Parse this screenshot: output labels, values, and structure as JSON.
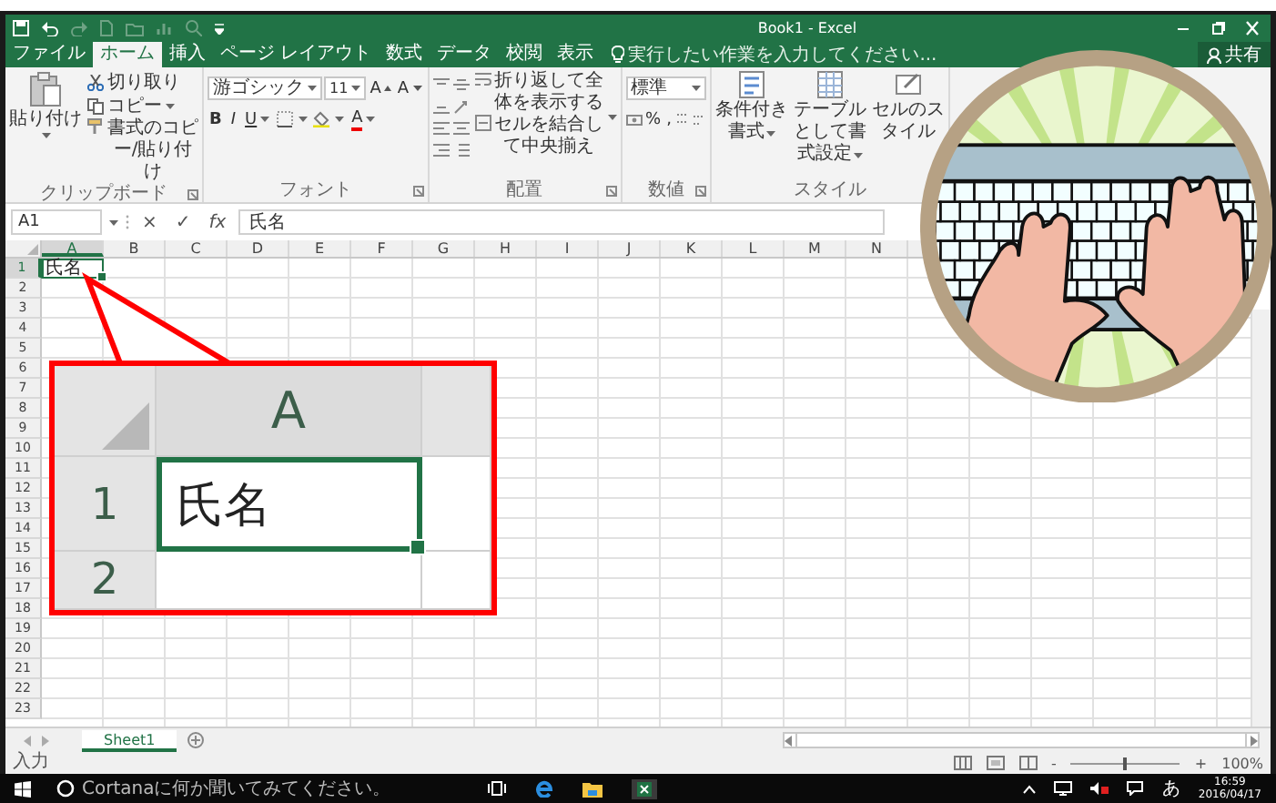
{
  "window": {
    "title": "Book1 - Excel"
  },
  "ribbon_tabs": [
    {
      "label": "ファイル",
      "selected": false
    },
    {
      "label": "ホーム",
      "selected": true
    },
    {
      "label": "挿入",
      "selected": false
    },
    {
      "label": "ページ レイアウト",
      "selected": false
    },
    {
      "label": "数式",
      "selected": false
    },
    {
      "label": "データ",
      "selected": false
    },
    {
      "label": "校閲",
      "selected": false
    },
    {
      "label": "表示",
      "selected": false
    }
  ],
  "tell_me": {
    "placeholder": "実行したい作業を入力してください..."
  },
  "share_button": "共有",
  "clipboard": {
    "paste": "貼り付け",
    "cut": "切り取り",
    "copy": "コピー",
    "format_painter": "書式のコピー/貼り付け",
    "label": "クリップボード"
  },
  "font": {
    "font_name": "游ゴシック",
    "font_size": "11",
    "grow": "A",
    "shrink": "A",
    "bold": "B",
    "italic": "I",
    "underline": "U",
    "font_color": "A",
    "label": "フォント"
  },
  "alignment": {
    "wrap_text": "折り返して全体を表示する",
    "merge_center": "セルを結合して中央揃え",
    "label": "配置"
  },
  "number": {
    "format": "標準",
    "percent": "%",
    "comma": ",",
    "label": "数値"
  },
  "styles": {
    "buttons": [
      "条件付き書式",
      "テーブルとして書式設定",
      "セルのスタイル"
    ],
    "label": "スタイル"
  },
  "formula_bar": {
    "name_box": "A1",
    "cancel": "×",
    "enter": "✓",
    "function": "fx",
    "value": "氏名"
  },
  "sheet": {
    "columns": [
      {
        "label": "A",
        "selected": true
      },
      {
        "label": "B",
        "selected": false
      },
      {
        "label": "C",
        "selected": false
      },
      {
        "label": "D",
        "selected": false
      },
      {
        "label": "E",
        "selected": false
      },
      {
        "label": "F",
        "selected": false
      },
      {
        "label": "G",
        "selected": false
      },
      {
        "label": "H",
        "selected": false
      },
      {
        "label": "I",
        "selected": false
      },
      {
        "label": "J",
        "selected": false
      },
      {
        "label": "K",
        "selected": false
      },
      {
        "label": "L",
        "selected": false
      },
      {
        "label": "M",
        "selected": false
      },
      {
        "label": "N",
        "selected": false
      }
    ],
    "rows": [
      {
        "label": "1",
        "selected": true,
        "cells": [
          {
            "text": "氏名",
            "selected": true
          }
        ]
      },
      {
        "label": "2",
        "selected": false
      },
      {
        "label": "3",
        "selected": false
      },
      {
        "label": "4",
        "selected": false
      },
      {
        "label": "5",
        "selected": false
      },
      {
        "label": "6",
        "selected": false
      },
      {
        "label": "7",
        "selected": false
      },
      {
        "label": "8",
        "selected": false
      },
      {
        "label": "9",
        "selected": false
      },
      {
        "label": "10",
        "selected": false
      },
      {
        "label": "11",
        "selected": false
      },
      {
        "label": "12",
        "selected": false
      },
      {
        "label": "13",
        "selected": false
      },
      {
        "label": "14",
        "selected": false
      },
      {
        "label": "15",
        "selected": false
      },
      {
        "label": "16",
        "selected": false
      },
      {
        "label": "17",
        "selected": false
      },
      {
        "label": "18",
        "selected": false
      },
      {
        "label": "19",
        "selected": false
      },
      {
        "label": "20",
        "selected": false
      },
      {
        "label": "21",
        "selected": false
      },
      {
        "label": "22",
        "selected": false
      },
      {
        "label": "23",
        "selected": false
      }
    ]
  },
  "callout": {
    "column": "A",
    "row": "1",
    "cell": "氏名",
    "next_row": "2"
  },
  "sheet_tabs": [
    {
      "label": "Sheet1",
      "selected": true
    }
  ],
  "status_bar": {
    "mode": "入力",
    "zoom_out": "-",
    "zoom_slider": {
      "level": 0.5
    },
    "zoom_in": "+",
    "zoom": "100%"
  },
  "taskbar": {
    "search": {
      "placeholder": "Cortanaに何か聞いてみてください。"
    },
    "ime": "あ",
    "time": "16:59",
    "date": "2016/04/17"
  }
}
